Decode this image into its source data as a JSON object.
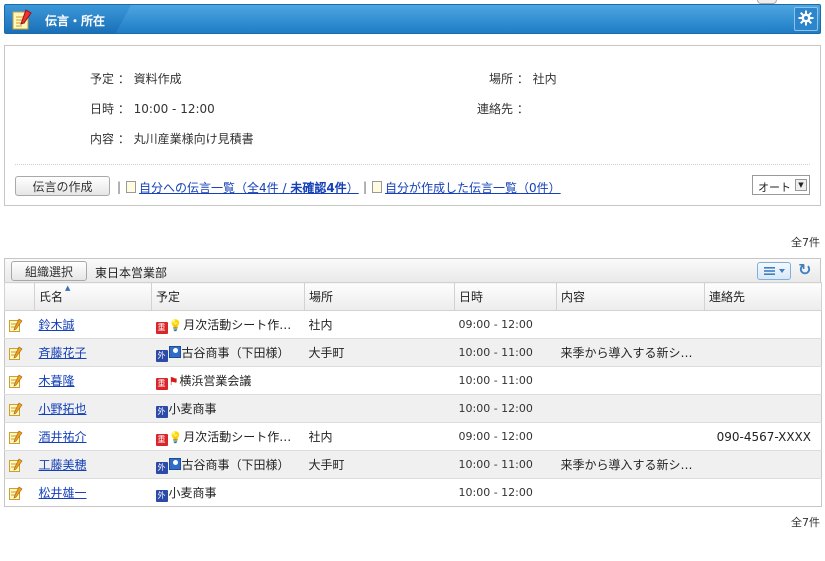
{
  "header": {
    "title": "伝言・所在"
  },
  "detail": {
    "yotei_label": "予定 ：",
    "yotei_value": "資料作成",
    "basho_label": "場所 ：",
    "basho_value": "社内",
    "nichiji_label": "日時 ：",
    "nichiji_value": "10:00 - 12:00",
    "renrakusaki_label": "連絡先 ：",
    "renrakusaki_value": "",
    "naiyo_label": "内容 ：",
    "naiyo_value": "丸川産業様向け見積書"
  },
  "actions": {
    "create_button": "伝言の作成",
    "separator": "|",
    "list_to_me_prefix": "自分への伝言一覧（",
    "list_to_me_total": "全4件",
    "list_to_me_slash": " / ",
    "list_to_me_unconfirmed": "未確認4件",
    "list_to_me_suffix": "）",
    "list_by_me": "自分が作成した伝言一覧（0件）",
    "mode_select": "オート"
  },
  "list": {
    "count_top": "全7件",
    "count_bottom": "全7件",
    "org_button": "組織選択",
    "org_name": "東日本営業部",
    "columns": [
      "氏名",
      "予定",
      "場所",
      "日時",
      "内容",
      "連絡先"
    ],
    "rows": [
      {
        "name": "鈴木誠",
        "badge": "重",
        "badge_color": "red",
        "icon": "bulb-icon",
        "schedule": "月次活動シート作…",
        "place": "社内",
        "time": "09:00 - 12:00",
        "content": "",
        "contact": ""
      },
      {
        "name": "斉藤花子",
        "badge": "外",
        "badge_color": "blue",
        "icon": "person-icon",
        "schedule": "古谷商事（下田様）",
        "place": "大手町",
        "time": "10:00 - 11:00",
        "content": "来季から導入する新シ…",
        "contact": ""
      },
      {
        "name": "木暮隆",
        "badge": "重",
        "badge_color": "red",
        "icon": "flag-icon",
        "schedule": "横浜営業会議",
        "place": "",
        "time": "10:00 - 11:00",
        "content": "",
        "contact": ""
      },
      {
        "name": "小野拓也",
        "badge": "外",
        "badge_color": "blue",
        "icon": "",
        "schedule": "小麦商事",
        "place": "",
        "time": "10:00 - 12:00",
        "content": "",
        "contact": ""
      },
      {
        "name": "酒井祐介",
        "badge": "重",
        "badge_color": "red",
        "icon": "bulb-icon",
        "schedule": "月次活動シート作…",
        "place": "社内",
        "time": "09:00 - 12:00",
        "content": "",
        "contact": "090-4567-XXXX"
      },
      {
        "name": "工藤美穂",
        "badge": "外",
        "badge_color": "blue",
        "icon": "person-icon",
        "schedule": "古谷商事（下田様）",
        "place": "大手町",
        "time": "10:00 - 11:00",
        "content": "来季から導入する新シ…",
        "contact": ""
      },
      {
        "name": "松井雄一",
        "badge": "外",
        "badge_color": "blue",
        "icon": "",
        "schedule": "小麦商事",
        "place": "",
        "time": "10:00 - 12:00",
        "content": "",
        "contact": ""
      }
    ]
  },
  "colors": {
    "header_blue": "#1f7dc6",
    "link_blue": "#1540b8",
    "badge_red": "#d9262a",
    "badge_blue": "#2c4aa8"
  }
}
